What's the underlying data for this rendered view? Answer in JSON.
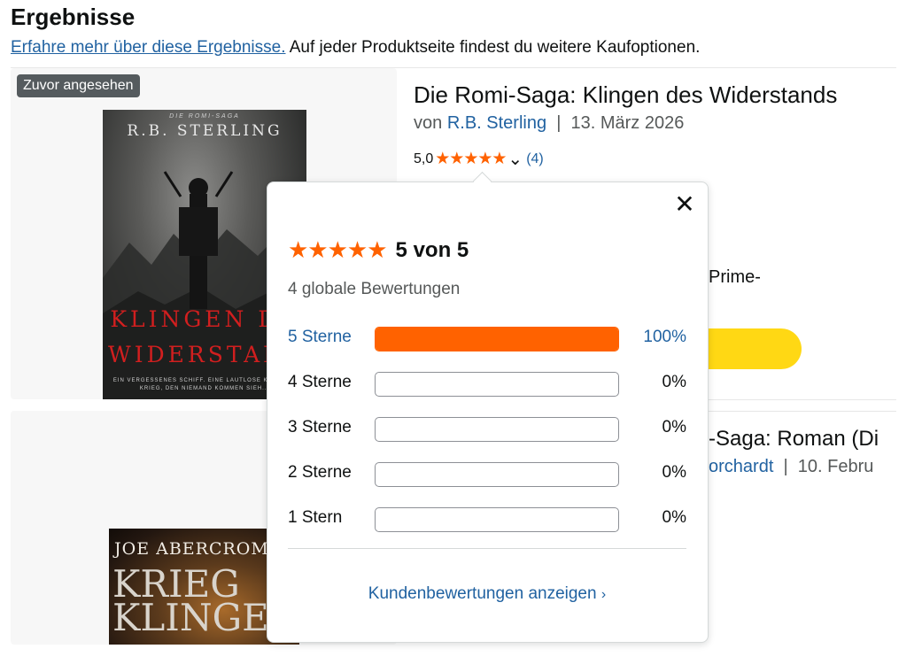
{
  "page": {
    "title": "Ergebnisse",
    "info_link": "Erfahre mehr über diese Ergebnisse.",
    "info_text": " Auf jeder Produktseite findest du weitere Kaufoptionen."
  },
  "product1": {
    "badge": "Zuvor angesehen",
    "cover": {
      "series": "DIE ROMI-SAGA",
      "author": "R.B. STERLING",
      "title_line1": "KLINGEN DE",
      "title_line2": "WIDERSTAN",
      "tagline": "EIN VERGESSENES SCHIFF. EINE LAUTLOSE KRI... EIN KRIEG, DEN NIEMAND KOMMEN SIEH..."
    },
    "title": "Die Romi-Saga: Klingen des Widerstands",
    "by_prefix": "von ",
    "author": "R.B. Sterling",
    "separator": "  |  ",
    "date": "13. März 2026",
    "rating_value": "5,0",
    "stars": "★★★★★",
    "chevron": "⌄",
    "rating_count": "(4)",
    "prime_partial": "Prime-"
  },
  "product2": {
    "title_partial": "-Saga: Roman (Di",
    "author_partial": "orchardt",
    "separator": "  |  ",
    "date_partial": "10. Febru",
    "cover": {
      "author": "JOE ABERCROM",
      "title_line1": "KRIEG",
      "title_line2": "KLINGE"
    }
  },
  "popover": {
    "close_glyph": "✕",
    "stars": "★★★★★",
    "summary": "5 von 5",
    "global_ratings": "4 globale Bewertungen",
    "histogram": [
      {
        "label": "5 Sterne",
        "percent": 100,
        "percent_text": "100%",
        "link": true
      },
      {
        "label": "4 Sterne",
        "percent": 0,
        "percent_text": "0%",
        "link": false
      },
      {
        "label": "3 Sterne",
        "percent": 0,
        "percent_text": "0%",
        "link": false
      },
      {
        "label": "2 Sterne",
        "percent": 0,
        "percent_text": "0%",
        "link": false
      },
      {
        "label": "1 Stern",
        "percent": 0,
        "percent_text": "0%",
        "link": false
      }
    ],
    "footer_link": "Kundenbewertungen anzeigen",
    "footer_chevron": "›"
  },
  "colors": {
    "star_orange": "#ff6200",
    "link_blue": "#2162a1",
    "cart_yellow": "#ffd814"
  }
}
